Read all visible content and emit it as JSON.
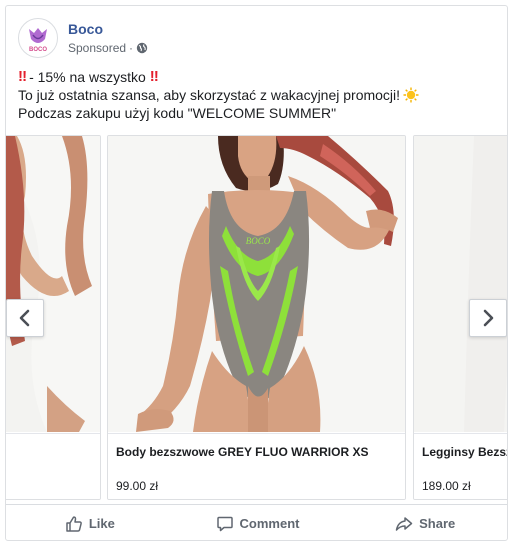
{
  "post": {
    "page_name": "Boco",
    "sponsored_label": "Sponsored",
    "separator": "·",
    "avatar_logo_text": "BOCO",
    "text_lines": [
      {
        "bang_before": "‼",
        "text": "- 15% na wszystko",
        "bang_after": "‼"
      },
      {
        "text": "To już ostatnia szansa, aby skorzystać z wakacyjnej promocji!",
        "emoji": "sun-emoji"
      },
      {
        "text": "Podczas zakupu użyj kodu \"WELCOME SUMMER\""
      }
    ]
  },
  "carousel": {
    "cards": [
      {
        "title": "",
        "price": ""
      },
      {
        "title": "Body bezszwowe GREY FLUO WARRIOR XS",
        "price": "99.00 zł",
        "image_logo_text": "BOCO"
      },
      {
        "title": "Legginsy Bezsz",
        "price": "189.00 zł"
      }
    ],
    "prev_icon": "chevron-left-icon",
    "next_icon": "chevron-right-icon"
  },
  "actions": {
    "like": "Like",
    "comment": "Comment",
    "share": "Share"
  },
  "colors": {
    "link_blue": "#385898",
    "muted": "#606770",
    "fluo_green": "#8ee03a",
    "body_grey": "#8a8680"
  }
}
